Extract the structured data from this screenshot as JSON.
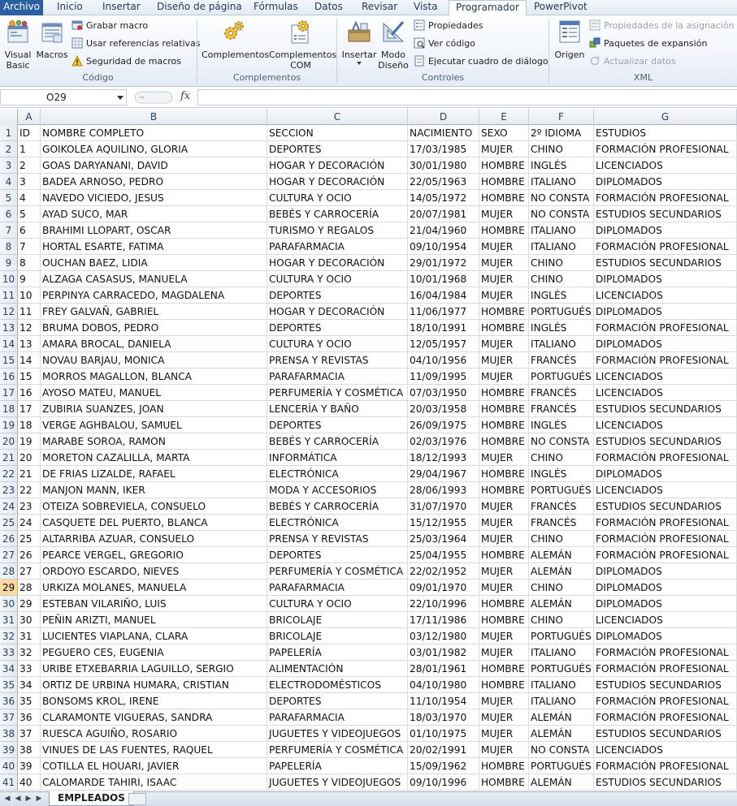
{
  "tabs": {
    "file": "Archivo",
    "items": [
      "Inicio",
      "Insertar",
      "Diseño de página",
      "Fórmulas",
      "Datos",
      "Revisar",
      "Vista",
      "Programador",
      "PowerPivot"
    ]
  },
  "ribbon": {
    "codigo": {
      "label": "Código",
      "visual_basic": "Visual\nBasic",
      "macros": "Macros",
      "grabar_macro": "Grabar macro",
      "referencias_relativas": "Usar referencias relativas",
      "seguridad_macros": "Seguridad de macros"
    },
    "complementos": {
      "label": "Complementos",
      "complementos": "Complementos",
      "complementos_com": "Complementos\nCOM"
    },
    "controles": {
      "label": "Controles",
      "insertar": "Insertar",
      "modo_diseno": "Modo\nDiseño",
      "propiedades": "Propiedades",
      "ver_codigo": "Ver código",
      "ejecutar_dialogo": "Ejecutar cuadro de diálogo"
    },
    "xml": {
      "label": "XML",
      "origen": "Origen",
      "propiedades_asignacion": "Propiedades de la asignación",
      "paquetes_expansion": "Paquetes de expansión",
      "actualizar_datos": "Actualizar datos"
    }
  },
  "formula_bar": {
    "name_box": "O29",
    "fx": "fx",
    "formula": ""
  },
  "columns": [
    "A",
    "B",
    "C",
    "D",
    "E",
    "F",
    "G"
  ],
  "selected_row": 29,
  "rows": [
    [
      "ID",
      "NOMBRE COMPLETO",
      "SECCION",
      "NACIMIENTO",
      "SEXO",
      "2º IDIOMA",
      "ESTUDIOS"
    ],
    [
      "1",
      "GOIKOLEA AQUILINO, GLORIA",
      "DEPORTES",
      "17/03/1985",
      "MUJER",
      "CHINO",
      "FORMACIÓN PROFESIONAL"
    ],
    [
      "2",
      "GOAS DARYANANI, DAVID",
      "HOGAR Y DECORACIÓN",
      "30/01/1980",
      "HOMBRE",
      "INGLÉS",
      "LICENCIADOS"
    ],
    [
      "3",
      "BADEA ARNOSO, PEDRO",
      "HOGAR Y DECORACIÓN",
      "22/05/1963",
      "HOMBRE",
      "ITALIANO",
      "DIPLOMADOS"
    ],
    [
      "4",
      "NAVEDO VICIEDO, JESUS",
      "CULTURA Y OCIO",
      "14/05/1972",
      "HOMBRE",
      "NO CONSTA",
      "FORMACIÓN PROFESIONAL"
    ],
    [
      "5",
      "AYAD SUCO, MAR",
      "BEBÉS Y CARROCERÍA",
      "20/07/1981",
      "MUJER",
      "NO CONSTA",
      "ESTUDIOS SECUNDARIOS"
    ],
    [
      "6",
      "BRAHIMI LLOPART, OSCAR",
      "TURISMO Y REGALOS",
      "21/04/1960",
      "HOMBRE",
      "ITALIANO",
      "DIPLOMADOS"
    ],
    [
      "7",
      "HORTAL ESARTE, FATIMA",
      "PARAFARMACIA",
      "09/10/1954",
      "MUJER",
      "ITALIANO",
      "FORMACIÓN PROFESIONAL"
    ],
    [
      "8",
      "OUCHAN BAEZ, LIDIA",
      "HOGAR Y DECORACIÓN",
      "29/01/1972",
      "MUJER",
      "CHINO",
      "ESTUDIOS SECUNDARIOS"
    ],
    [
      "9",
      "ALZAGA CASASUS, MANUELA",
      "CULTURA Y OCIO",
      "10/01/1968",
      "MUJER",
      "CHINO",
      "DIPLOMADOS"
    ],
    [
      "10",
      "PERPINYA CARRACEDO, MAGDALENA",
      "DEPORTES",
      "16/04/1984",
      "MUJER",
      "INGLÉS",
      "LICENCIADOS"
    ],
    [
      "11",
      "FREY GALVAÑ, GABRIEL",
      "HOGAR Y DECORACIÓN",
      "11/06/1977",
      "HOMBRE",
      "PORTUGUÉS",
      "DIPLOMADOS"
    ],
    [
      "12",
      "BRUMA DOBOS, PEDRO",
      "DEPORTES",
      "18/10/1991",
      "HOMBRE",
      "INGLÉS",
      "FORMACIÓN PROFESIONAL"
    ],
    [
      "13",
      "AMARA BROCAL, DANIELA",
      "CULTURA Y OCIO",
      "12/05/1957",
      "MUJER",
      "ITALIANO",
      "DIPLOMADOS"
    ],
    [
      "14",
      "NOVAU BARJAU, MONICA",
      "PRENSA Y REVISTAS",
      "04/10/1956",
      "MUJER",
      "FRANCÉS",
      "FORMACIÓN PROFESIONAL"
    ],
    [
      "15",
      "MORROS MAGALLON, BLANCA",
      "PARAFARMACIA",
      "11/09/1995",
      "MUJER",
      "PORTUGUÉS",
      "LICENCIADOS"
    ],
    [
      "16",
      "AYOSO MATEU, MANUEL",
      "PERFUMERÍA Y COSMÉTICA",
      "07/03/1950",
      "HOMBRE",
      "FRANCÉS",
      "LICENCIADOS"
    ],
    [
      "17",
      "ZUBIRIA SUANZES, JOAN",
      "LENCERÍA Y BAÑO",
      "20/03/1958",
      "HOMBRE",
      "FRANCÉS",
      "ESTUDIOS SECUNDARIOS"
    ],
    [
      "18",
      "VERGE AGHBALOU, SAMUEL",
      "DEPORTES",
      "26/09/1975",
      "HOMBRE",
      "INGLÉS",
      "LICENCIADOS"
    ],
    [
      "19",
      "MARABE SOROA, RAMON",
      "BEBÉS Y CARROCERÍA",
      "02/03/1976",
      "HOMBRE",
      "NO CONSTA",
      "ESTUDIOS SECUNDARIOS"
    ],
    [
      "20",
      "MORETON CAZALILLA, MARTA",
      "INFORMÁTICA",
      "18/12/1993",
      "MUJER",
      "CHINO",
      "FORMACIÓN PROFESIONAL"
    ],
    [
      "21",
      "DE FRIAS LIZALDE, RAFAEL",
      "ELECTRÓNICA",
      "29/04/1967",
      "HOMBRE",
      "INGLÉS",
      "DIPLOMADOS"
    ],
    [
      "22",
      "MANJON MANN, IKER",
      "MODA Y ACCESORIOS",
      "28/06/1993",
      "HOMBRE",
      "PORTUGUÉS",
      "LICENCIADOS"
    ],
    [
      "23",
      "OTEIZA SOBREVIELA, CONSUELO",
      "BEBÉS Y CARROCERÍA",
      "31/07/1970",
      "MUJER",
      "FRANCÉS",
      "ESTUDIOS SECUNDARIOS"
    ],
    [
      "24",
      "CASQUETE DEL PUERTO, BLANCA",
      "ELECTRÓNICA",
      "15/12/1955",
      "MUJER",
      "FRANCÉS",
      "FORMACIÓN PROFESIONAL"
    ],
    [
      "25",
      "ALTARRIBA AZUAR, CONSUELO",
      "PRENSA Y REVISTAS",
      "25/03/1964",
      "MUJER",
      "CHINO",
      "FORMACIÓN PROFESIONAL"
    ],
    [
      "26",
      "PEARCE VERGEL, GREGORIO",
      "DEPORTES",
      "25/04/1955",
      "HOMBRE",
      "ALEMÁN",
      "FORMACIÓN PROFESIONAL"
    ],
    [
      "27",
      "ORDOYO ESCARDO, NIEVES",
      "PERFUMERÍA Y COSMÉTICA",
      "22/02/1952",
      "MUJER",
      "ALEMÁN",
      "DIPLOMADOS"
    ],
    [
      "28",
      "URKIZA MOLANES, MANUELA",
      "PARAFARMACIA",
      "09/01/1970",
      "MUJER",
      "CHINO",
      "DIPLOMADOS"
    ],
    [
      "29",
      "ESTEBAN VILARIÑO, LUIS",
      "CULTURA Y OCIO",
      "22/10/1996",
      "HOMBRE",
      "ALEMÁN",
      "DIPLOMADOS"
    ],
    [
      "30",
      "PEÑIN ARIZTI, MANUEL",
      "BRICOLAJE",
      "17/11/1986",
      "HOMBRE",
      "CHINO",
      "LICENCIADOS"
    ],
    [
      "31",
      "LUCIENTES VIAPLANA, CLARA",
      "BRICOLAJE",
      "03/12/1980",
      "MUJER",
      "PORTUGUÉS",
      "DIPLOMADOS"
    ],
    [
      "32",
      "PEGUERO CES, EUGENIA",
      "PAPELERÍA",
      "03/01/1982",
      "MUJER",
      "ITALIANO",
      "FORMACIÓN PROFESIONAL"
    ],
    [
      "33",
      "URIBE ETXEBARRIA LAGUILLO, SERGIO",
      "ALIMENTACIÓN",
      "28/01/1961",
      "HOMBRE",
      "PORTUGUÉS",
      "FORMACIÓN PROFESIONAL"
    ],
    [
      "34",
      "ORTIZ DE URBINA HUMARA, CRISTIAN",
      "ELECTRODOMÉSTICOS",
      "04/10/1980",
      "HOMBRE",
      "ITALIANO",
      "ESTUDIOS SECUNDARIOS"
    ],
    [
      "35",
      "BONSOMS KROL, IRENE",
      "DEPORTES",
      "11/10/1954",
      "MUJER",
      "ITALIANO",
      "FORMACIÓN PROFESIONAL"
    ],
    [
      "36",
      "CLARAMONTE VIGUERAS, SANDRA",
      "PARAFARMACIA",
      "18/03/1970",
      "MUJER",
      "ALEMÁN",
      "FORMACIÓN PROFESIONAL"
    ],
    [
      "37",
      "RUESCA AGUIÑO, ROSARIO",
      "JUGUETES Y VIDEOJUEGOS",
      "01/10/1975",
      "MUJER",
      "ALEMÁN",
      "ESTUDIOS SECUNDARIOS"
    ],
    [
      "38",
      "VINUES DE LAS FUENTES, RAQUEL",
      "PERFUMERÍA Y COSMÉTICA",
      "20/02/1991",
      "MUJER",
      "NO CONSTA",
      "LICENCIADOS"
    ],
    [
      "39",
      "COTILLA EL HOUARI, JAVIER",
      "PAPELERÍA",
      "15/09/1962",
      "HOMBRE",
      "PORTUGUÉS",
      "FORMACIÓN PROFESIONAL"
    ],
    [
      "40",
      "CALOMARDE TAHIRI, ISAAC",
      "JUGUETES Y VIDEOJUEGOS",
      "09/10/1996",
      "HOMBRE",
      "ALEMÁN",
      "ESTUDIOS SECUNDARIOS"
    ]
  ],
  "sheets": [
    "EMPLEADOS"
  ],
  "colors": {
    "file_tab": "#2a5ea6",
    "selected_rowhead": "#f9d99f",
    "ribbon_text": "#1e395b"
  }
}
